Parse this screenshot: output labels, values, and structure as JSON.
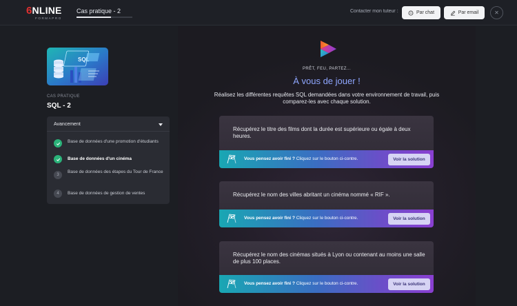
{
  "header": {
    "logo_main": "NLINE",
    "logo_prefix": "6",
    "logo_sub": "FORMAPRO",
    "breadcrumb": "Cas pratique - 2",
    "breadcrumb_progress": 0.62,
    "contact_label": "Contacter mon tuteur :",
    "chat_label": "Par chat",
    "email_label": "Par email",
    "close_symbol": "✕"
  },
  "sidebar": {
    "case_label": "CAS PRATIQUE",
    "case_title": "SQL - 2",
    "progress_title": "Avancement",
    "steps": [
      {
        "label": "Base de données d'une promotion d'étudiants",
        "status": "done",
        "number": "1"
      },
      {
        "label": "Base de données d'un cinéma",
        "status": "done",
        "number": "2"
      },
      {
        "label": "Base de données des étapes du Tour de France",
        "status": "todo",
        "number": "3"
      },
      {
        "label": "Base de données de gestion de ventes",
        "status": "todo",
        "number": "4"
      }
    ]
  },
  "main": {
    "kicker": "PRÊT, FEU, PARTEZ...",
    "headline": "À vous de jouer !",
    "intro": "Réalisez les différentes requêtes SQL demandées dans votre environnement de travail, puis comparez-les avec chaque solution.",
    "footer_bold": "Vous pensez avoir fini ?",
    "footer_text": " Cliquez sur le bouton ci-contre.",
    "solution_label": "Voir la solution",
    "exercises": [
      {
        "text": "Récupérez le titre des films dont la durée est supérieure ou égale à deux heures."
      },
      {
        "text": "Récupérez le nom des villes abritant un cinéma nommé « RIF »."
      },
      {
        "text": "Récupérez le nom des cinémas situés à Lyon ou contenant au moins une salle de plus 100 places."
      }
    ]
  },
  "colors": {
    "accent_blue": "#8fa6ff",
    "done_green": "#2bb37a",
    "brand_red": "#e03030"
  },
  "icons": {
    "chat": "chat-bubble-icon",
    "email": "pencil-icon",
    "close": "close-icon",
    "flag": "checkered-flag-icon",
    "check": "check-icon",
    "play": "play-logo-icon"
  }
}
